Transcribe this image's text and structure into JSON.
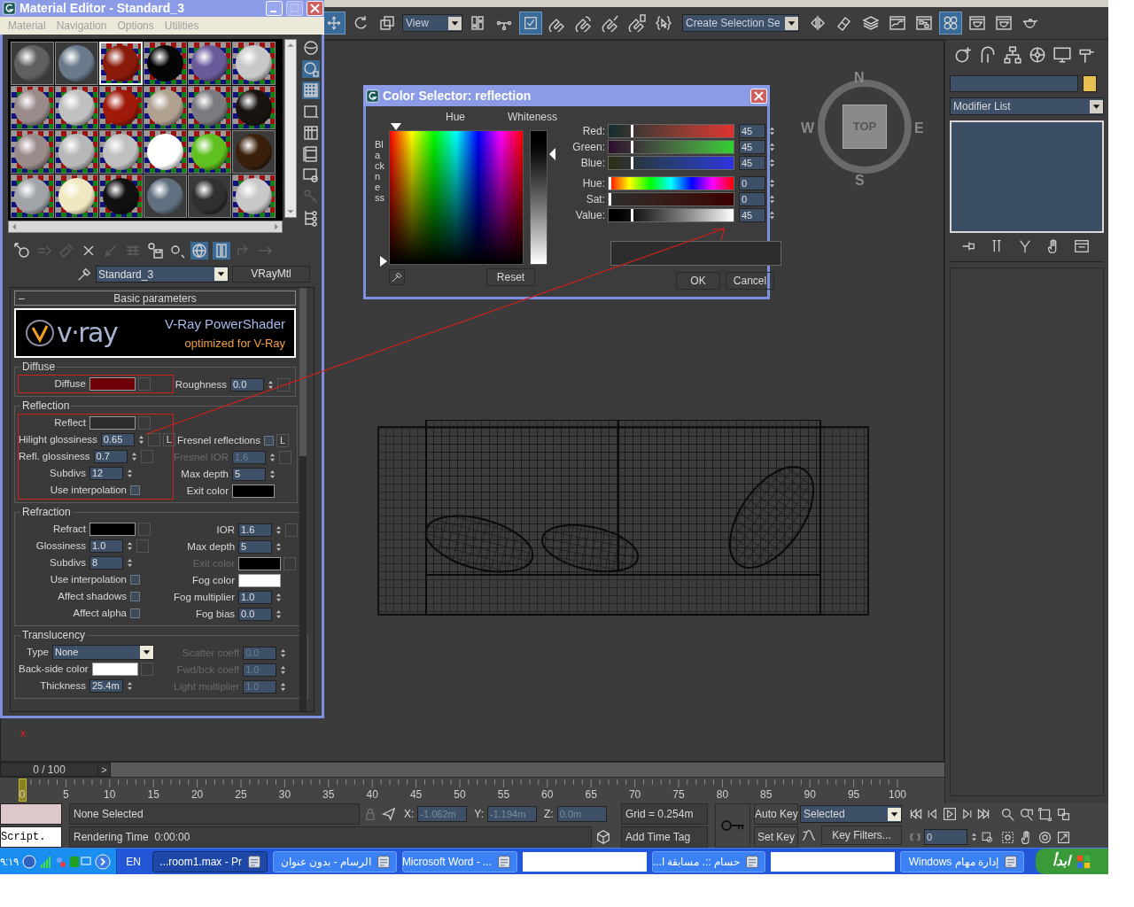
{
  "main_toolbar": [
    {
      "kind": "tool",
      "selected": true
    },
    {
      "kind": "tool",
      "selected": false
    },
    {
      "kind": "tool",
      "selected": false
    },
    {
      "kind": "dropdown",
      "value": "View"
    },
    {
      "kind": "tool",
      "selected": false
    },
    {
      "kind": "tool",
      "selected": false
    },
    {
      "kind": "tool",
      "selected": true
    },
    {
      "kind": "tool",
      "selected": false
    },
    {
      "kind": "tool",
      "selected": false
    },
    {
      "kind": "tool",
      "selected": false
    },
    {
      "kind": "tool",
      "selected": false
    },
    {
      "kind": "tool",
      "selected": false
    },
    {
      "kind": "dropdown",
      "value": "Create Selection Se"
    },
    {
      "kind": "tool",
      "selected": false
    },
    {
      "kind": "tool",
      "selected": false
    },
    {
      "kind": "tool",
      "selected": false
    },
    {
      "kind": "tool",
      "selected": false
    },
    {
      "kind": "tool",
      "selected": false
    },
    {
      "kind": "tool",
      "selected": true
    },
    {
      "kind": "tool",
      "selected": false
    },
    {
      "kind": "tool",
      "selected": false
    },
    {
      "kind": "tool",
      "selected": false
    }
  ],
  "viewport": {
    "viewcube_label": "TOP",
    "compass": [
      "N",
      "W",
      "E",
      "S"
    ],
    "axis_label": "x"
  },
  "command_panel": {
    "modifier_list": "Modifier List"
  },
  "material_editor": {
    "title": "Material Editor - Standard_3",
    "menu": [
      "Material",
      "Navigation",
      "Options",
      "Utilities"
    ],
    "slots": [
      {
        "color": "#606060",
        "checker": false,
        "selected": false
      },
      {
        "color": "#6a7a8a",
        "checker": false,
        "selected": false
      },
      {
        "color": "#8a1a0a",
        "checker": true,
        "selected": true
      },
      {
        "color": "#050505",
        "checker": true,
        "selected": false
      },
      {
        "color": "#6a5a9a",
        "checker": true,
        "selected": false
      },
      {
        "color": "#c8c8c8",
        "checker": true,
        "selected": false
      },
      {
        "color": "#9a8a8a",
        "checker": true,
        "selected": false
      },
      {
        "color": "#c0c0c0",
        "checker": true,
        "selected": false
      },
      {
        "color": "#a01a0a",
        "checker": true,
        "selected": false
      },
      {
        "color": "#b0a090",
        "checker": true,
        "selected": false
      },
      {
        "color": "#7a7a80",
        "checker": true,
        "selected": false
      },
      {
        "color": "#1a1410",
        "checker": true,
        "selected": false
      },
      {
        "color": "#9a8a8a",
        "checker": true,
        "selected": false
      },
      {
        "color": "#b8b8b8",
        "checker": true,
        "selected": false
      },
      {
        "color": "#c0c0c0",
        "checker": true,
        "selected": false
      },
      {
        "color": "#ffffff",
        "checker": true,
        "selected": false
      },
      {
        "color": "#60c020",
        "checker": true,
        "selected": false
      },
      {
        "color": "#3a200c",
        "checker": false,
        "selected": false
      },
      {
        "color": "#a0a4a8",
        "checker": true,
        "selected": false
      },
      {
        "color": "#f0e8c0",
        "checker": true,
        "selected": false
      },
      {
        "color": "#101010",
        "checker": true,
        "selected": false
      },
      {
        "color": "#607080",
        "checker": false,
        "selected": false
      },
      {
        "color": "#303030",
        "checker": false,
        "selected": false
      },
      {
        "color": "#c8c8c8",
        "checker": true,
        "selected": false
      }
    ],
    "side_tools": [
      {
        "selected": false,
        "disabled": false
      },
      {
        "selected": true,
        "disabled": false
      },
      {
        "selected": true,
        "disabled": false
      },
      {
        "selected": false,
        "disabled": false
      },
      {
        "selected": false,
        "disabled": false
      },
      {
        "selected": false,
        "disabled": false
      },
      {
        "selected": false,
        "disabled": false
      },
      {
        "selected": false,
        "disabled": true
      },
      {
        "selected": false,
        "disabled": false
      }
    ],
    "tools": [
      {
        "selected": false,
        "disabled": false
      },
      {
        "selected": false,
        "disabled": true
      },
      {
        "selected": false,
        "disabled": true
      },
      {
        "selected": false,
        "disabled": false
      },
      {
        "selected": false,
        "disabled": true
      },
      {
        "selected": false,
        "disabled": true
      },
      {
        "selected": false,
        "disabled": false
      },
      {
        "selected": false,
        "disabled": false
      },
      {
        "selected": true,
        "disabled": false
      },
      {
        "selected": true,
        "disabled": false
      },
      {
        "selected": false,
        "disabled": true
      },
      {
        "selected": false,
        "disabled": true
      }
    ],
    "material_name": "Standard_3",
    "material_type": "VRayMtl",
    "rollout": {
      "sign": "–",
      "title": "Basic parameters"
    },
    "banner": {
      "logo": "v·ray",
      "title": "V-Ray PowerShader",
      "subtitle": "optimized for V-Ray"
    },
    "groups": [
      {
        "title": "Diffuse",
        "boxed": true,
        "left": [
          {
            "kind": "color",
            "label": "Diffuse",
            "color": "#6e0008",
            "map": true,
            "disabled": false
          }
        ],
        "right": [
          {
            "kind": "spinner",
            "label": "Roughness",
            "value": "0.0",
            "map": true,
            "disabled": false
          }
        ]
      },
      {
        "title": "Reflection",
        "boxed": true,
        "left": [
          {
            "kind": "color",
            "label": "Reflect",
            "color": "#2d2d2d",
            "map": true,
            "disabled": false
          },
          {
            "kind": "spinner",
            "label": "Hilight glossiness",
            "value": "0.65",
            "map": true,
            "lock": "L",
            "disabled": false
          },
          {
            "kind": "spinner",
            "label": "Refl. glossiness",
            "value": "0.7",
            "map": true,
            "disabled": false
          },
          {
            "kind": "spinner",
            "label": "Subdivs",
            "value": "12",
            "map": false,
            "disabled": false
          },
          {
            "kind": "checkbox",
            "label": "Use interpolation",
            "checked": false,
            "disabled": false
          }
        ],
        "right": [
          {
            "kind": "checkbox",
            "label": "Fresnel reflections",
            "checked": false,
            "lock": "L",
            "disabled": false
          },
          {
            "kind": "spinner",
            "label": "Fresnel IOR",
            "value": "1.6",
            "map": true,
            "disabled": true
          },
          {
            "kind": "spinner",
            "label": "Max depth",
            "value": "5",
            "map": false,
            "disabled": false
          },
          {
            "kind": "color",
            "label": "Exit color",
            "color": "#000000",
            "map": false,
            "disabled": false
          }
        ]
      },
      {
        "title": "Refraction",
        "boxed": false,
        "left": [
          {
            "kind": "color",
            "label": "Refract",
            "color": "#000000",
            "map": true,
            "disabled": false
          },
          {
            "kind": "spinner",
            "label": "Glossiness",
            "value": "1.0",
            "map": true,
            "disabled": false
          },
          {
            "kind": "spinner",
            "label": "Subdivs",
            "value": "8",
            "map": false,
            "disabled": false
          },
          {
            "kind": "checkbox",
            "label": "Use interpolation",
            "checked": false,
            "disabled": false
          },
          {
            "kind": "checkbox",
            "label": "Affect shadows",
            "checked": false,
            "disabled": false
          },
          {
            "kind": "checkbox",
            "label": "Affect alpha",
            "checked": false,
            "disabled": false
          }
        ],
        "right": [
          {
            "kind": "spinner",
            "label": "IOR",
            "value": "1.6",
            "map": true,
            "disabled": false
          },
          {
            "kind": "spinner",
            "label": "Max depth",
            "value": "5",
            "map": false,
            "disabled": false
          },
          {
            "kind": "color",
            "label": "Exit color",
            "color": "#000000",
            "map": true,
            "disabled": true
          },
          {
            "kind": "color",
            "label": "Fog color",
            "color": "#ffffff",
            "map": false,
            "disabled": false
          },
          {
            "kind": "spinner",
            "label": "Fog multiplier",
            "value": "1.0",
            "map": false,
            "disabled": false
          },
          {
            "kind": "spinner",
            "label": "Fog bias",
            "value": "0.0",
            "map": false,
            "disabled": false
          }
        ]
      },
      {
        "title": "Translucency",
        "boxed": false,
        "left": [
          {
            "kind": "dropdown",
            "label": "Type",
            "value": "None",
            "disabled": false
          },
          {
            "kind": "color",
            "label": "Back-side color",
            "color": "#ffffff",
            "map": true,
            "disabled": false
          },
          {
            "kind": "spinner",
            "label": "Thickness",
            "value": "25.4m",
            "map": false,
            "disabled": false
          }
        ],
        "right": [
          {
            "kind": "spinner",
            "label": "Scatter coeff",
            "value": "0.0",
            "map": false,
            "disabled": true
          },
          {
            "kind": "spinner",
            "label": "Fwd/bck coeff",
            "value": "1.0",
            "map": false,
            "disabled": true
          },
          {
            "kind": "spinner",
            "label": "Light multiplier",
            "value": "1.0",
            "map": false,
            "disabled": true
          }
        ]
      }
    ]
  },
  "color_selector": {
    "title": "Color Selector: reflection",
    "hue_label": "Hue",
    "whiteness_label": "Whiteness",
    "blackness_label": "Blackness",
    "channels": [
      {
        "kind": "red",
        "label": "Red:",
        "value": "45",
        "level": 0.176
      },
      {
        "kind": "green",
        "label": "Green:",
        "value": "45",
        "level": 0.176
      },
      {
        "kind": "blue",
        "label": "Blue:",
        "value": "45",
        "level": 0.176
      },
      {
        "kind": "hue",
        "label": "Hue:",
        "value": "0",
        "level": 0
      },
      {
        "kind": "sat",
        "label": "Sat:",
        "value": "0",
        "level": 0
      },
      {
        "kind": "value",
        "label": "Value:",
        "value": "45",
        "level": 0.176
      }
    ],
    "reset": "Reset",
    "ok": "OK",
    "cancel": "Cancel"
  },
  "timeline": {
    "position": "0 / 100",
    "next": ">",
    "level": 0,
    "ruler_labels": [
      "0",
      "5",
      "10",
      "15",
      "20",
      "25",
      "30",
      "35",
      "40",
      "45",
      "50",
      "55",
      "60",
      "65",
      "70",
      "75",
      "80",
      "85",
      "90",
      "95",
      "100"
    ]
  },
  "status": {
    "selection": "None Selected",
    "prompt": "Rendering Time  0:00:00",
    "script": "Script.",
    "coords": [
      {
        "label": "X:",
        "value": "-1.062m"
      },
      {
        "label": "Y:",
        "value": "-1.194m"
      },
      {
        "label": "Z:",
        "value": "0.0m"
      }
    ],
    "grid": "Grid = 0.254m",
    "time_tag": "Add Time Tag",
    "auto_key": "Auto Key",
    "set_key": "Set Key",
    "key_mode": "Selected",
    "key_filters": "Key Filters...",
    "frame": "0"
  },
  "taskbar": {
    "clock": "٩:١٩",
    "language": "EN",
    "tasks": [
      {
        "label": "إدارة مهام Windows",
        "selected": false
      },
      {
        "label": "حسام ::. مسابقة ا...",
        "selected": false
      },
      {
        "label": "Microsoft Word - ...",
        "selected": false
      },
      {
        "label": "الرسام - بدون عنوان",
        "selected": false
      },
      {
        "label": "...room1.max - Pr",
        "selected": true
      }
    ],
    "start": "ابدأ"
  }
}
